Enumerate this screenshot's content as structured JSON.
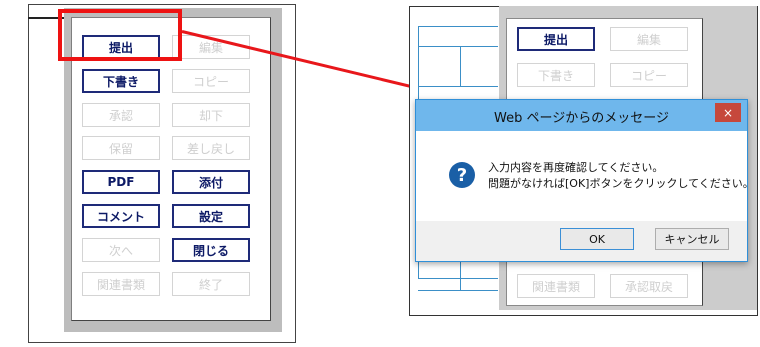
{
  "left_panel": {
    "buttons": [
      {
        "label": "提出",
        "enabled": true
      },
      {
        "label": "編集",
        "enabled": false
      },
      {
        "label": "下書き",
        "enabled": true
      },
      {
        "label": "コピー",
        "enabled": false
      },
      {
        "label": "承認",
        "enabled": false
      },
      {
        "label": "却下",
        "enabled": false
      },
      {
        "label": "保留",
        "enabled": false
      },
      {
        "label": "差し戻し",
        "enabled": false
      },
      {
        "label": "PDF",
        "enabled": true
      },
      {
        "label": "添付",
        "enabled": true
      },
      {
        "label": "コメント",
        "enabled": true
      },
      {
        "label": "設定",
        "enabled": true
      },
      {
        "label": "次へ",
        "enabled": false
      },
      {
        "label": "閉じる",
        "enabled": true
      },
      {
        "label": "関連書類",
        "enabled": false
      },
      {
        "label": "終了",
        "enabled": false
      }
    ]
  },
  "right_panel": {
    "buttons_top": [
      {
        "label": "提出",
        "enabled": true
      },
      {
        "label": "編集",
        "enabled": false
      },
      {
        "label": "下書き",
        "enabled": false
      },
      {
        "label": "コピー",
        "enabled": false
      }
    ],
    "buttons_bottom": [
      {
        "label": "関連書類",
        "enabled": false
      },
      {
        "label": "承認取戻",
        "enabled": false
      }
    ]
  },
  "dialog": {
    "title": "Web ページからのメッセージ",
    "close_label": "×",
    "icon": "question-icon",
    "icon_glyph": "?",
    "message_line1": "入力内容を再度確認してください。",
    "message_line2": "問題がなければ[OK]ボタンをクリックしてください。",
    "ok_label": "OK",
    "cancel_label": "キャンセル"
  },
  "colors": {
    "highlight": "#ee1212",
    "button_border": "#1e2a78",
    "dialog_title_bar": "#6fb7ec",
    "close_button": "#c6483c",
    "question_icon": "#1a5fa6"
  }
}
